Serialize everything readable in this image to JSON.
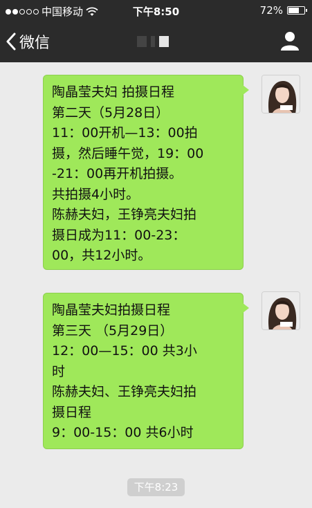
{
  "status_bar": {
    "carrier": "中国移动",
    "time": "下午8:50",
    "battery_percent": "72%",
    "battery_level": 0.72,
    "signal_dots_filled": 2,
    "signal_dots_total": 5
  },
  "nav": {
    "back_label": "微信"
  },
  "messages": [
    {
      "lines": [
        "陶晶莹夫妇 拍摄日程",
        "第二天（5月28日）",
        "11：00开机—13：00拍",
        "摄，然后睡午觉，19：00",
        "-21：00再开机拍摄。",
        "共拍摄4小时。",
        "陈赫夫妇，王铮亮夫妇拍",
        "摄日成为11：00-23：",
        "00，共12小时。"
      ]
    },
    {
      "lines": [
        "陶晶莹夫妇拍摄日程",
        "第三天 （5月29日）",
        "12：00—15：00 共3小",
        "时",
        "陈赫夫妇、王铮亮夫妇拍",
        "摄日程",
        "9：00-15：00 共6小时"
      ]
    }
  ],
  "timestamp": "下午8:23",
  "colors": {
    "bar": "#2b2b2b",
    "bubble": "#9fe85a",
    "background": "#ebebeb"
  },
  "icons": [
    "signal-dots-icon",
    "wifi-icon",
    "battery-icon",
    "back-chevron-icon",
    "person-icon"
  ]
}
